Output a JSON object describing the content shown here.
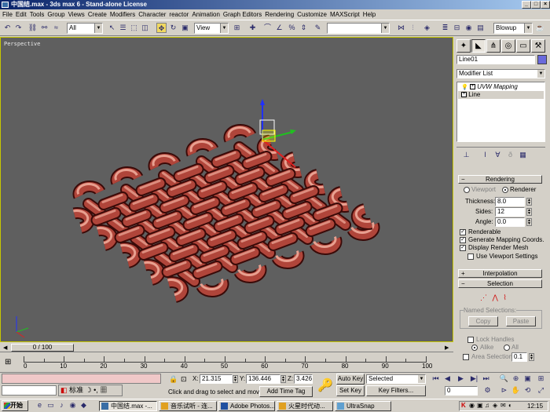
{
  "window": {
    "title": "中国结.max - 3ds max 6 - Stand-alone License"
  },
  "menu": [
    "File",
    "Edit",
    "Tools",
    "Group",
    "Views",
    "Create",
    "Modifiers",
    "Character",
    "reactor",
    "Animation",
    "Graph Editors",
    "Rendering",
    "Customize",
    "MAXScript",
    "Help"
  ],
  "toolbar": {
    "selection_filter": "All",
    "reference_coord": "View",
    "named_selection": "",
    "render_type": "Blowup"
  },
  "viewport": {
    "label": "Perspective"
  },
  "command_panel": {
    "object_name": "Line01",
    "modifier_list": "Modifier List",
    "stack": [
      "UVW Mapping",
      "Line"
    ],
    "rendering": {
      "header": "Rendering",
      "viewport_label": "Viewport",
      "renderer_label": "Renderer",
      "selected_mode": "Renderer",
      "thickness_label": "Thickness:",
      "thickness": "8.0",
      "sides_label": "Sides:",
      "sides": "12",
      "angle_label": "Angle:",
      "angle": "0.0",
      "renderable_label": "Renderable",
      "renderable": true,
      "gen_mapping_label": "Generate Mapping Coords.",
      "gen_mapping": true,
      "display_mesh_label": "Display Render Mesh",
      "display_mesh": true,
      "use_vp_settings_label": "Use Viewport Settings",
      "use_vp_settings": false
    },
    "interpolation_header": "Interpolation",
    "selection": {
      "header": "Selection",
      "named_selections_label": "Named Selections:",
      "copy_label": "Copy",
      "paste_label": "Paste",
      "lock_handles_label": "Lock Handles",
      "alike_label": "Alike",
      "all_label": "All",
      "area_selection_label": "Area Selection:",
      "area_selection_value": "0.1"
    }
  },
  "timeline": {
    "frame_display": "0 / 100",
    "ticks": [
      "0",
      "10",
      "20",
      "30",
      "40",
      "50",
      "60",
      "70",
      "80",
      "90",
      "100"
    ]
  },
  "status": {
    "ime_label": "标准",
    "x_label": "X:",
    "x_value": "21.315",
    "y_label": "Y:",
    "y_value": "136.446",
    "z_label": "Z:",
    "z_value": "3.426",
    "prompt": "Click and drag to select and move",
    "add_time_tag": "Add Time Tag",
    "auto_key": "Auto Key",
    "set_key": "Set Key",
    "key_mode_value": "Selected",
    "key_filters": "Key Filters...",
    "current_frame": "0"
  },
  "taskbar": {
    "start_label": "开始",
    "tasks": [
      "中国结.max -...",
      "音乐试听 - 连...",
      "Adobe Photos...",
      "火星时代动...",
      "UltraSnap"
    ],
    "clock": "12:15"
  },
  "colors": {
    "knot_light": "#e8a090",
    "knot_mid": "#b0453a",
    "knot_dark": "#4a0e0a",
    "viewport_bg": "#5f5f5f",
    "active_border": "#c8c800"
  }
}
